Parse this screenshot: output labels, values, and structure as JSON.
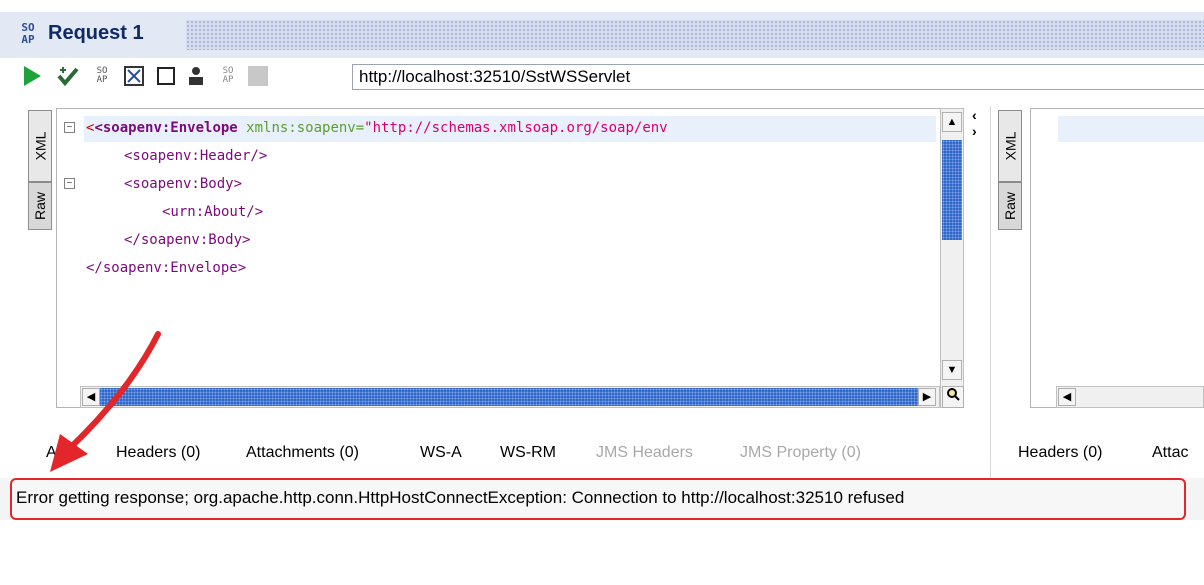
{
  "window": {
    "logo_text": "SO\nAP",
    "title": "Request 1"
  },
  "toolbar": {
    "icons": [
      "play-icon",
      "check-icon",
      "soap-icon",
      "format-icon",
      "square-icon",
      "user-icon",
      "soap-small-icon",
      "stop-icon"
    ],
    "endpoint_url": "http://localhost:32510/SstWSServlet"
  },
  "request": {
    "side_tabs": [
      "XML",
      "Raw"
    ],
    "code": {
      "line1_tag": "<soapenv:Envelope",
      "line1_attr": " xmlns:soapenv=",
      "line1_str": "\"http://schemas.xmlsoap.org/soap/env",
      "line2": "<soapenv:Header/>",
      "line3": "<soapenv:Body>",
      "line4": "<urn:About/>",
      "line5": "</soapenv:Body>",
      "line6": "</soapenv:Envelope>"
    },
    "bottom_tabs": {
      "auth": "Auth",
      "headers": "Headers (0)",
      "attachments": "Attachments (0)",
      "wsa": "WS-A",
      "wsrm": "WS-RM",
      "jms_headers": "JMS Headers",
      "jms_property": "JMS Property (0)"
    }
  },
  "response": {
    "side_tabs": [
      "XML",
      "Raw"
    ],
    "bottom_tabs": {
      "headers": "Headers (0)",
      "attachments": "Attac"
    }
  },
  "status": {
    "error_message": "Error getting response; org.apache.http.conn.HttpHostConnectException: Connection to http://localhost:32510 refused"
  },
  "colors": {
    "annotation": "#e3262a",
    "scroll_thumb": "#2f66c8",
    "title_text": "#112a66"
  }
}
